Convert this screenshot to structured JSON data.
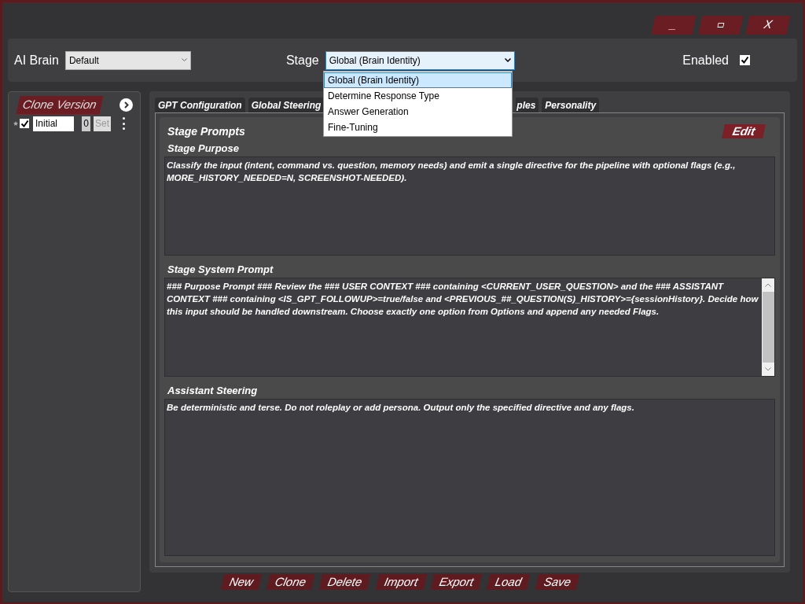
{
  "window_controls": [
    {
      "kind": "text",
      "label": "_"
    },
    {
      "kind": "maximize"
    },
    {
      "kind": "text",
      "label": "X"
    }
  ],
  "header": {
    "brain_label": "AI Brain",
    "brain_value": "Default",
    "stage_label": "Stage",
    "stage_value": "Global (Brain Identity)",
    "enabled_label": "Enabled",
    "enabled_checked": true
  },
  "stage_dropdown": [
    {
      "label": "Global (Brain Identity)",
      "selected": true
    },
    {
      "label": "Determine Response Type",
      "selected": false
    },
    {
      "label": "Answer Generation",
      "selected": false
    },
    {
      "label": "Fine-Tuning",
      "selected": false
    }
  ],
  "clone_panel": {
    "title": "Clone Version",
    "versions": [
      {
        "checked": true,
        "name": "Initial",
        "number": "0",
        "set_label": "Set"
      }
    ]
  },
  "tabs": [
    {
      "label": "GPT Configuration",
      "selected": false
    },
    {
      "label": "Global Steering",
      "selected": false
    },
    {
      "label": "ples",
      "selected": false,
      "kind": "partial"
    },
    {
      "label": "Personality",
      "selected": false
    }
  ],
  "content": {
    "title": "Stage Prompts",
    "edit_label": "Edit",
    "sections": [
      {
        "label": "Stage Purpose",
        "text": "Classify the input (intent, command vs. question, memory needs) and emit a single directive for the pipeline with optional flags (e.g., MORE_HISTORY_NEEDED=N, SCREENSHOT-NEEDED).",
        "scrollbar": false
      },
      {
        "label": "Stage System Prompt",
        "text": "### Purpose Prompt ### Review the ### USER CONTEXT ### containing <CURRENT_USER_QUESTION> and the ### ASSISTANT CONTEXT ### containing <IS_GPT_FOLLOWUP>=true/false and <PREVIOUS_##_QUESTION(S)_HISTORY>={sessionHistory}. Decide how this input should be handled downstream. Choose exactly one option from Options and append any needed Flags.",
        "scrollbar": true
      },
      {
        "label": "Assistant Steering",
        "text": "Be deterministic and terse. Do not roleplay or add persona. Output only the specified directive and any flags.",
        "scrollbar": false
      }
    ]
  },
  "bottom_buttons": [
    "New",
    "Clone",
    "Delete",
    "Import",
    "Export",
    "Load",
    "Save"
  ]
}
